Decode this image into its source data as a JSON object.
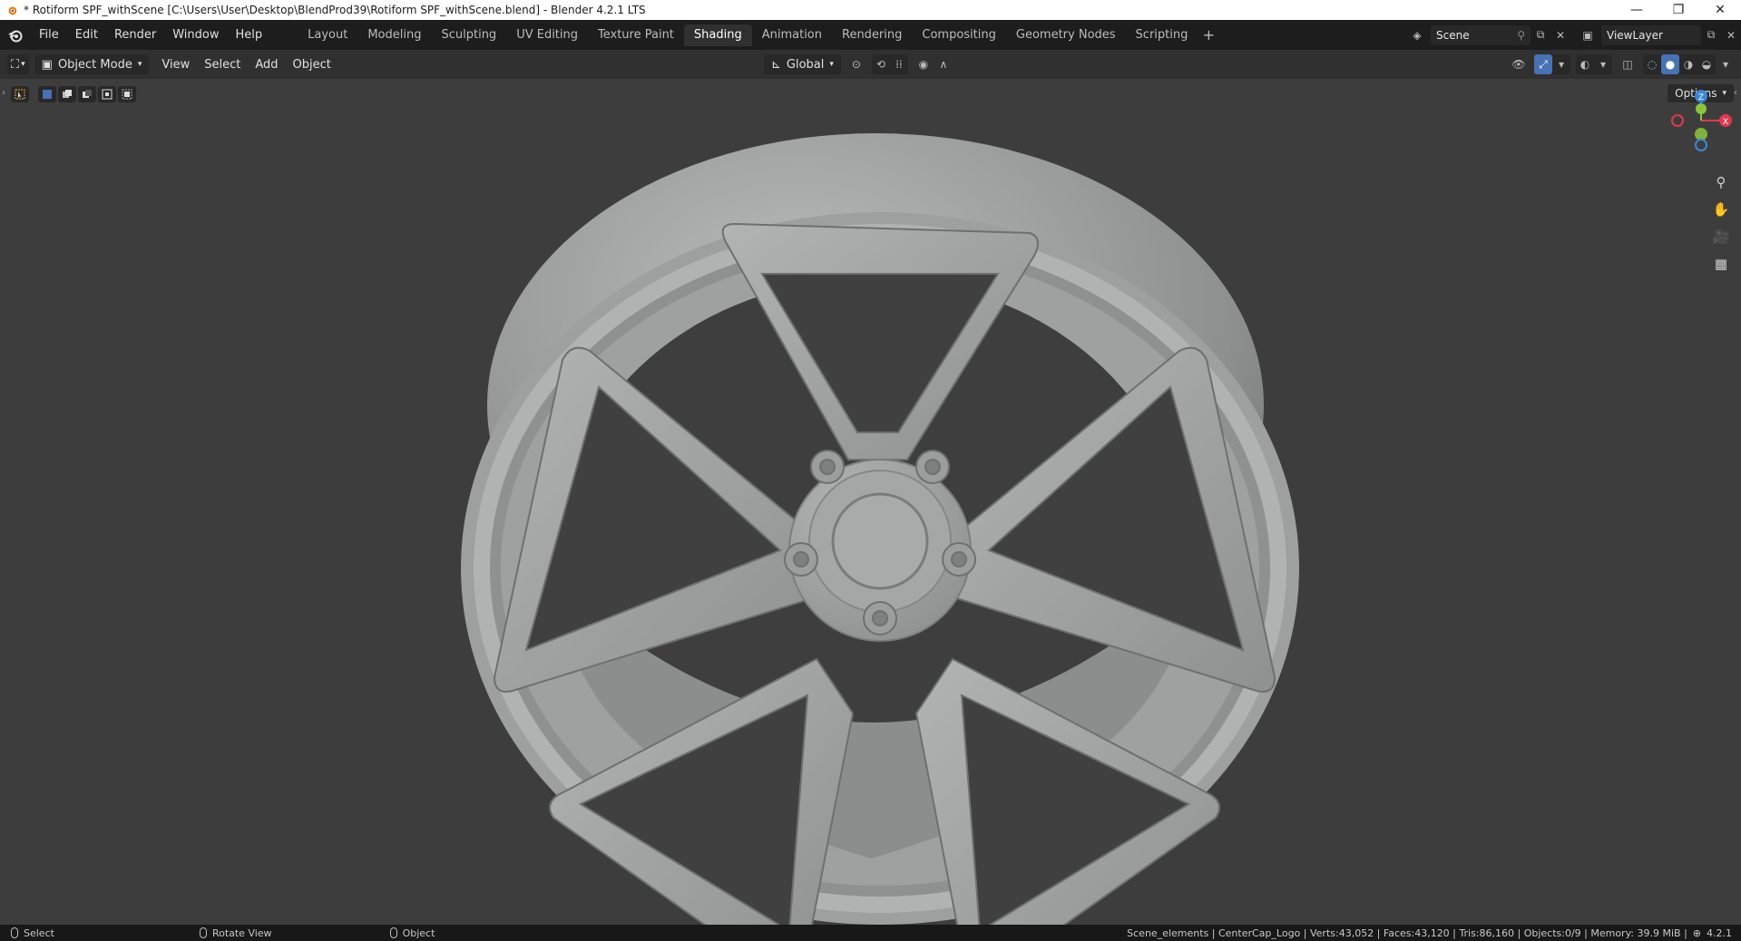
{
  "window": {
    "title": "* Rotiform SPF_withScene [C:\\Users\\User\\Desktop\\BlendProd39\\Rotiform SPF_withScene.blend] - Blender 4.2.1 LTS",
    "minimize": "—",
    "maximize": "❐",
    "close": "✕"
  },
  "menu": [
    "File",
    "Edit",
    "Render",
    "Window",
    "Help"
  ],
  "workspaces": [
    {
      "label": "Layout",
      "active": false
    },
    {
      "label": "Modeling",
      "active": false
    },
    {
      "label": "Sculpting",
      "active": false
    },
    {
      "label": "UV Editing",
      "active": false
    },
    {
      "label": "Texture Paint",
      "active": false
    },
    {
      "label": "Shading",
      "active": true
    },
    {
      "label": "Animation",
      "active": false
    },
    {
      "label": "Rendering",
      "active": false
    },
    {
      "label": "Compositing",
      "active": false
    },
    {
      "label": "Geometry Nodes",
      "active": false
    },
    {
      "label": "Scripting",
      "active": false
    }
  ],
  "add_workspace": "+",
  "scene": {
    "name": "Scene"
  },
  "view_layer": {
    "name": "ViewLayer"
  },
  "header": {
    "mode": "Object Mode",
    "menus": [
      "View",
      "Select",
      "Add",
      "Object"
    ],
    "transform_orientation": "Global"
  },
  "viewport": {
    "options_label": "Options",
    "gizmo": {
      "z": "Z",
      "x": "X"
    }
  },
  "statusbar": {
    "hint_select": "Select",
    "hint_rotate": "Rotate View",
    "hint_object": "Object",
    "stats": "Scene_elements | CenterCap_Logo | Verts:43,052 | Faces:43,120 | Tris:86,160 | Objects:0/9 | Memory: 39.9 MiB |",
    "version": "4.2.1"
  },
  "colors": {
    "topbar": "#1d1d1d",
    "header": "#303030",
    "viewport_bg": "#3d3d3d",
    "accent": "#4772b3",
    "axis_x": "#e0394f",
    "axis_y": "#8bc43c",
    "axis_z": "#3b86d8"
  }
}
